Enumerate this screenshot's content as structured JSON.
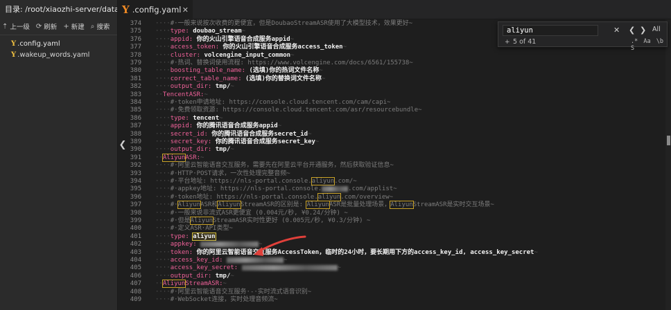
{
  "sidebar": {
    "path": "目录: /root/xiaozhi-server/data",
    "toolbar": [
      {
        "icon": "up-arrow-icon",
        "glyph": "⇡",
        "label": "上一级"
      },
      {
        "icon": "refresh-icon",
        "glyph": "⟳",
        "label": "刷新"
      },
      {
        "icon": "plus-icon",
        "glyph": "+",
        "label": "新建"
      },
      {
        "icon": "search-icon",
        "glyph": "⌕",
        "label": "搜索"
      }
    ],
    "files": [
      {
        "name": ".config.yaml"
      },
      {
        "name": ".wakeup_words.yaml"
      }
    ]
  },
  "tab": {
    "icon": "yaml-icon",
    "label": ".config.yaml",
    "close": "✕"
  },
  "find": {
    "query": "aliyun",
    "count": "5 of 41",
    "clear": "✕",
    "prev": "❮",
    "next": "❯",
    "all": "All",
    "plus": "+",
    "options": [
      ".*",
      "Aa",
      "\\b",
      "S"
    ]
  },
  "colors": {
    "accent": "#f0629a",
    "highlight": "#c9a227",
    "annotation": "#e0403a"
  },
  "editor": {
    "lines": [
      {
        "n": "374",
        "segs": [
          [
            "d",
            "····"
          ],
          [
            "c",
            "#·一般来说按次收费的更便宜，但是DoubaoStreamASR使用了大模型技术，效果更好~"
          ]
        ]
      },
      {
        "n": "375",
        "segs": [
          [
            "d",
            "····"
          ],
          [
            "k",
            "type:"
          ],
          [
            "s",
            " doubao_stream"
          ],
          [
            "d",
            "~"
          ]
        ]
      },
      {
        "n": "376",
        "segs": [
          [
            "d",
            "····"
          ],
          [
            "k",
            "appid:"
          ],
          [
            "s",
            " 你的火山引擎语音合成服务appid"
          ],
          [
            "d",
            "~"
          ]
        ]
      },
      {
        "n": "377",
        "segs": [
          [
            "d",
            "····"
          ],
          [
            "k",
            "access_token:"
          ],
          [
            "s",
            " 你的火山引擎语音合成服务access_token"
          ],
          [
            "d",
            "~"
          ]
        ]
      },
      {
        "n": "378",
        "segs": [
          [
            "d",
            "····"
          ],
          [
            "k",
            "cluster:"
          ],
          [
            "s",
            " volcengine_input_common"
          ],
          [
            "d",
            "~"
          ]
        ]
      },
      {
        "n": "379",
        "segs": [
          [
            "d",
            "····"
          ],
          [
            "c",
            "#·热词、替换词使用流程: https://www.volcengine.com/docs/6561/155738~"
          ]
        ]
      },
      {
        "n": "380",
        "segs": [
          [
            "d",
            "····"
          ],
          [
            "k",
            "boosting_table_name:"
          ],
          [
            "s",
            " (选填)你的热词文件名称"
          ],
          [
            "d",
            "~"
          ]
        ]
      },
      {
        "n": "381",
        "segs": [
          [
            "d",
            "····"
          ],
          [
            "k",
            "correct_table_name:"
          ],
          [
            "s",
            " (选填)你的替换词文件名称"
          ],
          [
            "d",
            "~"
          ]
        ]
      },
      {
        "n": "382",
        "segs": [
          [
            "d",
            "····"
          ],
          [
            "k",
            "output_dir:"
          ],
          [
            "s",
            " tmp/"
          ],
          [
            "d",
            "~"
          ]
        ]
      },
      {
        "n": "383",
        "segs": [
          [
            "d",
            "··"
          ],
          [
            "k",
            "TencentASR:"
          ],
          [
            "d",
            "~"
          ]
        ]
      },
      {
        "n": "384",
        "segs": [
          [
            "d",
            "····"
          ],
          [
            "c",
            "#·token申请地址: https://console.cloud.tencent.com/cam/capi~"
          ]
        ]
      },
      {
        "n": "385",
        "segs": [
          [
            "d",
            "····"
          ],
          [
            "c",
            "#·免费领取资源: https://console.cloud.tencent.com/asr/resourcebundle~"
          ]
        ]
      },
      {
        "n": "386",
        "segs": [
          [
            "d",
            "····"
          ],
          [
            "k",
            "type:"
          ],
          [
            "s",
            " tencent"
          ],
          [
            "d",
            "~"
          ]
        ]
      },
      {
        "n": "387",
        "segs": [
          [
            "d",
            "····"
          ],
          [
            "k",
            "appid:"
          ],
          [
            "s",
            " 你的腾讯语音合成服务appid"
          ],
          [
            "d",
            "~"
          ]
        ]
      },
      {
        "n": "388",
        "segs": [
          [
            "d",
            "····"
          ],
          [
            "k",
            "secret_id:"
          ],
          [
            "s",
            " 你的腾讯语音合成服务secret_id"
          ],
          [
            "d",
            "~"
          ]
        ]
      },
      {
        "n": "389",
        "segs": [
          [
            "d",
            "····"
          ],
          [
            "k",
            "secret_key:"
          ],
          [
            "s",
            " 你的腾讯语音合成服务secret_key"
          ],
          [
            "d",
            "~"
          ]
        ]
      },
      {
        "n": "390",
        "segs": [
          [
            "d",
            "····"
          ],
          [
            "k",
            "output_dir:"
          ],
          [
            "s",
            " tmp/"
          ],
          [
            "d",
            "~"
          ]
        ]
      },
      {
        "n": "391",
        "segs": [
          [
            "d",
            "··"
          ],
          [
            "kh",
            "Aliyun"
          ],
          [
            "k",
            "ASR:"
          ],
          [
            "d",
            "~"
          ]
        ]
      },
      {
        "n": "392",
        "segs": [
          [
            "d",
            "····"
          ],
          [
            "c",
            "#·阿里云智能语音交互服务，需要先在阿里云平台开通服务，然后获取验证信息~"
          ]
        ]
      },
      {
        "n": "393",
        "segs": [
          [
            "d",
            "····"
          ],
          [
            "c",
            "#·HTTP·POST请求，一次性处理完整音频~"
          ]
        ]
      },
      {
        "n": "394",
        "segs": [
          [
            "d",
            "····"
          ],
          [
            "c",
            "#·平台地址: https://nls-portal.console."
          ],
          [
            "ch",
            "aliyun"
          ],
          [
            "c",
            ".com/~"
          ]
        ]
      },
      {
        "n": "395",
        "segs": [
          [
            "d",
            "····"
          ],
          [
            "c",
            "#·appkey地址: https://nls-portal.console."
          ],
          [
            "blur",
            "38"
          ],
          [
            "c",
            ".com/applist~"
          ]
        ]
      },
      {
        "n": "396",
        "segs": [
          [
            "d",
            "····"
          ],
          [
            "c",
            "#·token地址: https://nls-portal.console."
          ],
          [
            "ch",
            "aliyun"
          ],
          [
            "c",
            ".com/overview~"
          ]
        ]
      },
      {
        "n": "397",
        "segs": [
          [
            "d",
            "····"
          ],
          [
            "c",
            "#·"
          ],
          [
            "ch",
            "Aliyun"
          ],
          [
            "c",
            "ASR和"
          ],
          [
            "ch",
            "Aliyun"
          ],
          [
            "c",
            "StreamASR的区别是: "
          ],
          [
            "ch",
            "Aliyun"
          ],
          [
            "c",
            "ASR是批量处理场景，"
          ],
          [
            "ch",
            "Aliyun"
          ],
          [
            "c",
            "StreamASR是实时交互场景~"
          ]
        ]
      },
      {
        "n": "398",
        "segs": [
          [
            "d",
            "····"
          ],
          [
            "c",
            "#·一般来说非流式ASR更便宜 (0.004元/秒, ¥0.24/分钟) ~"
          ]
        ]
      },
      {
        "n": "399",
        "segs": [
          [
            "d",
            "····"
          ],
          [
            "c",
            "#·但是"
          ],
          [
            "ch",
            "Aliyun"
          ],
          [
            "c",
            "StreamASR实时性更好 (0.005元/秒, ¥0.3/分钟) ~"
          ]
        ]
      },
      {
        "n": "400",
        "segs": [
          [
            "d",
            "····"
          ],
          [
            "c",
            "#·定义ASR·API类型~"
          ]
        ]
      },
      {
        "n": "401",
        "segs": [
          [
            "d",
            "····"
          ],
          [
            "k",
            "type:"
          ],
          [
            "s",
            " "
          ],
          [
            "sh",
            "aliyun"
          ]
        ]
      },
      {
        "n": "402",
        "segs": [
          [
            "d",
            "····"
          ],
          [
            "k",
            "appkey:"
          ],
          [
            "s",
            " "
          ],
          [
            "blur",
            "84"
          ],
          [
            "d",
            "~"
          ]
        ]
      },
      {
        "n": "403",
        "segs": [
          [
            "d",
            "····"
          ],
          [
            "k",
            "token:"
          ],
          [
            "s",
            " 你的阿里云智能语音交互服务AccessToken，临时的24小时，要长期用下方的access_key_id, access_key_secret"
          ],
          [
            "d",
            "~"
          ]
        ]
      },
      {
        "n": "404",
        "segs": [
          [
            "d",
            "····"
          ],
          [
            "k",
            "access_key_id:"
          ],
          [
            "s",
            " "
          ],
          [
            "blur",
            "82"
          ],
          [
            "d",
            "~"
          ]
        ]
      },
      {
        "n": "405",
        "segs": [
          [
            "d",
            "····"
          ],
          [
            "k",
            "access_key_secret:"
          ],
          [
            "s",
            " "
          ],
          [
            "blur",
            "138"
          ],
          [
            "d",
            "~"
          ]
        ]
      },
      {
        "n": "406",
        "segs": [
          [
            "d",
            "····"
          ],
          [
            "k",
            "output_dir:"
          ],
          [
            "s",
            " tmp/"
          ],
          [
            "d",
            "~"
          ]
        ]
      },
      {
        "n": "407",
        "segs": [
          [
            "d",
            "··"
          ],
          [
            "kh",
            "Aliyun"
          ],
          [
            "k",
            "StreamASR:"
          ],
          [
            "d",
            "~"
          ]
        ]
      },
      {
        "n": "408",
        "segs": [
          [
            "d",
            "····"
          ],
          [
            "c",
            "#·阿里云智能语音交互服务·-·实时流式语音识别~"
          ]
        ]
      },
      {
        "n": "409",
        "segs": [
          [
            "d",
            "····"
          ],
          [
            "c",
            "#·WebSocket连接，实时处理音频流~"
          ]
        ]
      }
    ]
  }
}
